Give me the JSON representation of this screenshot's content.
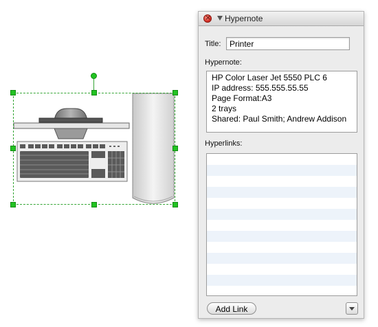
{
  "panel": {
    "title": "Hypernote",
    "title_label": "Title:",
    "title_value": "Printer",
    "hypernote_label": "Hypernote:",
    "hypernote_lines": [
      "HP Color Laser Jet 5550 PLC 6",
      "IP address: 555.555.55.55",
      "Page Format:A3",
      "2 trays",
      "Shared: Paul Smith; Andrew Addison"
    ],
    "hyperlinks_label": "Hyperlinks:",
    "add_link_label": "Add Link"
  },
  "icons": {
    "close": "close-icon",
    "disclosure": "disclosure-triangle-icon",
    "menu": "chevron-down-icon"
  },
  "colors": {
    "selection": "#22c322",
    "close_button": "#d8332a",
    "stripe": "#edf3fa"
  }
}
